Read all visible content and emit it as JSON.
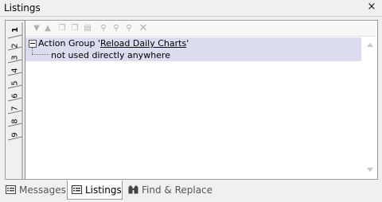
{
  "window": {
    "title": "Listings",
    "close_glyph": "×"
  },
  "side_tabs": [
    "1",
    "2",
    "3",
    "4",
    "5",
    "6",
    "7",
    "8",
    "9"
  ],
  "side_tabs_active": "1",
  "toolbar_icons": [
    "arrow-down-icon",
    "arrow-up-icon",
    "copy-icon",
    "copy-all-icon",
    "paste-icon",
    "find-icon",
    "find-prev-icon",
    "find-next-icon",
    "clear-icon"
  ],
  "tree": {
    "group_prefix": "Action Group '",
    "group_name": "Reload Daily Charts",
    "group_suffix": "'",
    "child_text": "not used directly anywhere"
  },
  "bottom_tabs": {
    "messages": "Messages",
    "listings": "Listings",
    "find_replace": "Find & Replace",
    "active": "Listings"
  },
  "colors": {
    "selection": "#dcdcf0",
    "panel_bg": "#f0f0f0"
  }
}
